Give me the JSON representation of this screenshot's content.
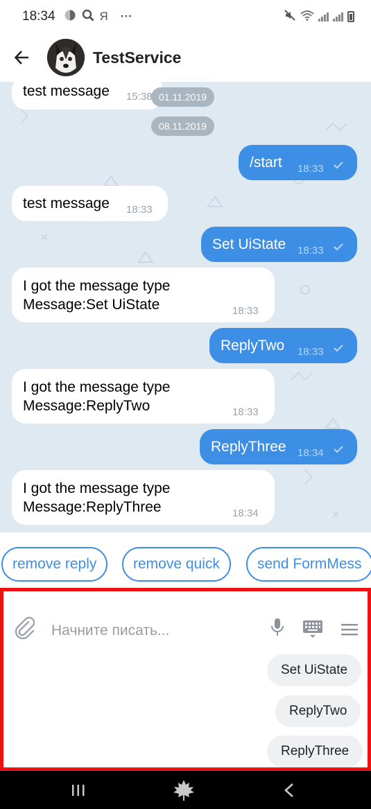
{
  "status_bar": {
    "time": "18:34",
    "icons": [
      "theme-icon",
      "search-icon",
      "yandex-icon",
      "more-icon"
    ],
    "yandex_glyph": "Я",
    "more_glyph": "···",
    "right_icons": [
      "mute-icon",
      "wifi-icon",
      "signal-icon",
      "signal-icon",
      "battery-icon"
    ]
  },
  "header": {
    "title": "TestService",
    "back_icon": "back-arrow-icon",
    "avatar": "husky-avatar"
  },
  "chat": {
    "dates": [
      "01.11.2019",
      "08.11.2019"
    ],
    "messages": [
      {
        "dir": "in",
        "lines": [
          "test message"
        ],
        "time": "15:38"
      },
      {
        "dir": "out",
        "lines": [
          "/start"
        ],
        "time": "18:33"
      },
      {
        "dir": "in",
        "lines": [
          "test message"
        ],
        "time": "18:33"
      },
      {
        "dir": "out",
        "lines": [
          "Set UiState"
        ],
        "time": "18:33"
      },
      {
        "dir": "in",
        "lines": [
          "I got the message type",
          "Message:Set UiState"
        ],
        "time": "18:33"
      },
      {
        "dir": "out",
        "lines": [
          "ReplyTwo"
        ],
        "time": "18:33"
      },
      {
        "dir": "in",
        "lines": [
          "I got the message type",
          "Message:ReplyTwo"
        ],
        "time": "18:33"
      },
      {
        "dir": "out",
        "lines": [
          "ReplyThree"
        ],
        "time": "18:34"
      },
      {
        "dir": "in",
        "lines": [
          "I got the message type",
          "Message:ReplyThree"
        ],
        "time": "18:34"
      }
    ]
  },
  "quick_buttons": [
    "remove reply",
    "remove quick",
    "send FormMess"
  ],
  "composer": {
    "placeholder": "Начните писать...",
    "icons": [
      "attach-icon",
      "microphone-icon",
      "keyboard-icon",
      "menu-icon"
    ]
  },
  "reply_chips": [
    "Set UiState",
    "ReplyTwo",
    "ReplyThree"
  ],
  "nav_bar": {
    "icons": [
      "recent-apps-icon",
      "home-icon",
      "back-icon"
    ]
  },
  "colors": {
    "accent": "#3d8fe5",
    "chat_bg": "#dfe9f2",
    "highlight_border": "#ee1111"
  }
}
